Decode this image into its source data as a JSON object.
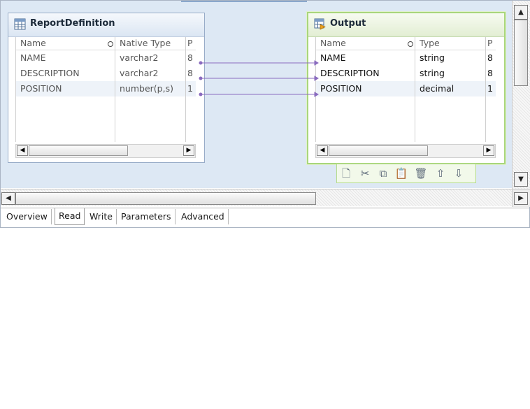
{
  "source": {
    "title": "ReportDefinition",
    "headers": [
      "Name",
      "Native Type",
      "P"
    ],
    "rows": [
      {
        "name": "NAME",
        "type": "varchar2",
        "p": "8"
      },
      {
        "name": "DESCRIPTION",
        "type": "varchar2",
        "p": "8"
      },
      {
        "name": "POSITION",
        "type": "number(p,s)",
        "p": "1"
      }
    ]
  },
  "output": {
    "title": "Output",
    "headers": [
      "Name",
      "Type",
      "P"
    ],
    "rows": [
      {
        "name": "NAME",
        "type": "string",
        "p": "8"
      },
      {
        "name": "DESCRIPTION",
        "type": "string",
        "p": "8"
      },
      {
        "name": "POSITION",
        "type": "decimal",
        "p": "1"
      }
    ]
  },
  "toolbar": [
    "new-field-icon",
    "cut-icon",
    "copy-icon",
    "paste-icon",
    "delete-icon",
    "move-up-icon",
    "move-down-icon"
  ],
  "tabs": [
    "Overview",
    "Read",
    "Write",
    "Parameters",
    "Advanced"
  ],
  "active_tab": "Read",
  "colors": {
    "link": "#8a6bbf",
    "canvas": "#dde8f4",
    "output_border": "#a9d67c"
  }
}
